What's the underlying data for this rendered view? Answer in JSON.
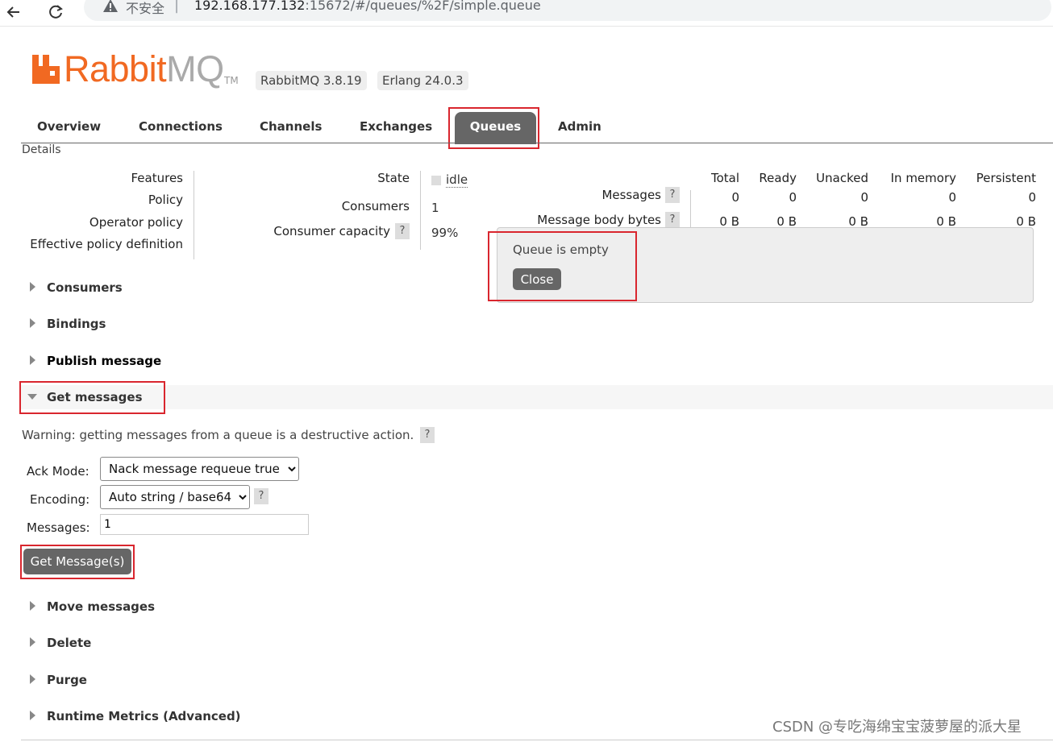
{
  "browser": {
    "security_label": "不安全",
    "url_host": "192.168.177.132",
    "url_rest": ":15672/#/queues/%2F/simple.queue"
  },
  "header": {
    "logo_word1": "Rabbit",
    "logo_word2": "MQ",
    "logo_tm": "TM",
    "rabbitmq_version": "RabbitMQ 3.8.19",
    "erlang_version": "Erlang 24.0.3"
  },
  "tabs": [
    {
      "label": "Overview"
    },
    {
      "label": "Connections"
    },
    {
      "label": "Channels"
    },
    {
      "label": "Exchanges"
    },
    {
      "label": "Queues"
    },
    {
      "label": "Admin"
    }
  ],
  "details": {
    "heading": "Details",
    "features_label": "Features",
    "policy_label": "Policy",
    "operator_policy_label": "Operator policy",
    "effective_policy_label": "Effective policy definition",
    "state_label": "State",
    "state_value": "idle",
    "consumers_label": "Consumers",
    "consumers_value": "1",
    "consumer_capacity_label": "Consumer capacity",
    "consumer_capacity_value": "99%",
    "help": "?"
  },
  "stats": {
    "columns": [
      "Total",
      "Ready",
      "Unacked",
      "In memory",
      "Persistent"
    ],
    "rows": [
      {
        "label": "Messages",
        "values": [
          "0",
          "0",
          "0",
          "0",
          "0"
        ]
      },
      {
        "label": "Message body bytes",
        "values": [
          "0 B",
          "0 B",
          "0 B",
          "0 B",
          "0 B"
        ]
      }
    ]
  },
  "popup": {
    "message": "Queue is empty",
    "close_label": "Close"
  },
  "sections": {
    "consumers": "Consumers",
    "bindings": "Bindings",
    "publish": "Publish message",
    "get_messages": "Get messages",
    "move": "Move messages",
    "delete": "Delete",
    "purge": "Purge",
    "runtime": "Runtime Metrics (Advanced)"
  },
  "get_messages": {
    "warning": "Warning: getting messages from a queue is a destructive action.",
    "ack_mode_label": "Ack Mode:",
    "ack_mode_value": "Nack message requeue true",
    "encoding_label": "Encoding:",
    "encoding_value": "Auto string / base64",
    "messages_label": "Messages:",
    "messages_value": "1",
    "button_label": "Get Message(s)"
  },
  "watermark": "CSDN @专吃海绵宝宝菠萝屋的派大星",
  "colors": {
    "brand_orange": "#f16922",
    "logo_gray": "#aaaaaa",
    "tab_active_bg": "#666666",
    "highlight_red": "#d9262e"
  }
}
